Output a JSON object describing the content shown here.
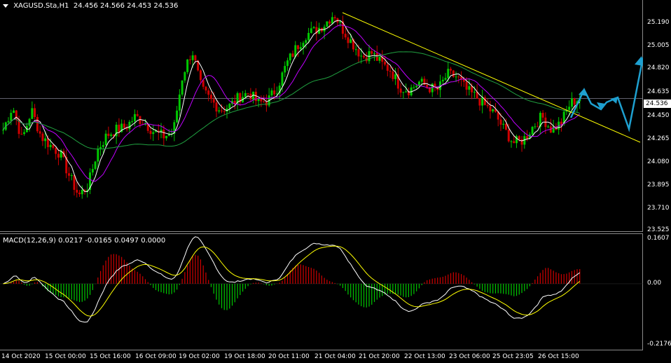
{
  "chart": {
    "title": "XAGUSD.Sta,H1",
    "ohlc": "24.456 24.566 24.453 24.536",
    "current_price": "24.536"
  },
  "price_axis": [
    "25.190",
    "25.005",
    "24.820",
    "24.635",
    "24.450",
    "24.265",
    "24.080",
    "23.895",
    "23.710",
    "23.525"
  ],
  "macd": {
    "title": "MACD(12,26,9) 0.0217 -0.0165 0.0497 0.0000",
    "axis": [
      "0.1607",
      "0.00",
      "-0.2176"
    ]
  },
  "time_axis": [
    "14 Oct 2020",
    "15 Oct 00:00",
    "15 Oct 16:00",
    "16 Oct 09:00",
    "19 Oct 02:00",
    "19 Oct 18:00",
    "20 Oct 11:00",
    "21 Oct 04:00",
    "21 Oct 20:00",
    "22 Oct 13:00",
    "23 Oct 06:00",
    "25 Oct 23:05",
    "26 Oct 15:00"
  ],
  "chart_data": {
    "type": "candlestick",
    "symbol": "XAGUSD.Sta",
    "timeframe": "H1",
    "ylim": [
      23.525,
      25.282
    ],
    "close_path": [
      24.3,
      24.48,
      24.22,
      24.45,
      24.25,
      24.18,
      24.12,
      23.95,
      23.8,
      23.88,
      24.15,
      24.26,
      24.3,
      24.32,
      24.4,
      24.35,
      24.28,
      24.25,
      24.28,
      24.72,
      24.9,
      24.6,
      24.52,
      24.45,
      24.48,
      24.55,
      24.58,
      24.5,
      24.52,
      24.62,
      24.8,
      24.92,
      25.02,
      25.05,
      25.1,
      25.18,
      25.05,
      24.95,
      24.85,
      24.88,
      24.8,
      24.75,
      24.62,
      24.6,
      24.66,
      24.62,
      24.6,
      24.72,
      24.7,
      24.6,
      24.55,
      24.48,
      24.42,
      24.3,
      24.2,
      24.22,
      24.32,
      24.4,
      24.3,
      24.35,
      24.5,
      24.54
    ],
    "colors": {
      "bull": "#00c800",
      "bear": "#d00000",
      "ma_fast": "#ffffff",
      "ma_mid": "#c000ff",
      "ma_slow": "#20a040",
      "trendline": "#ffff00",
      "projection": "#1ea0d0"
    },
    "macd": {
      "ylim": [
        -0.2176,
        0.1607
      ]
    }
  }
}
